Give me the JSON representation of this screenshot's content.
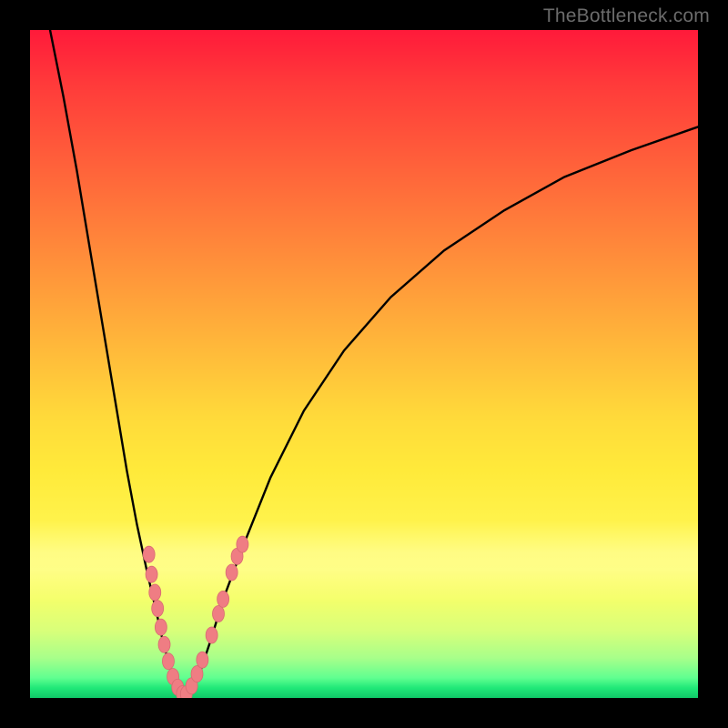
{
  "watermark": {
    "text": "TheBottleneck.com"
  },
  "colors": {
    "frame": "#000000",
    "curve_stroke": "#000000",
    "marker_fill": "#ef7d83",
    "marker_stroke": "#d86a72"
  },
  "chart_data": {
    "type": "line",
    "title": "",
    "xlabel": "",
    "ylabel": "",
    "xlim": [
      0,
      100
    ],
    "ylim": [
      0,
      100
    ],
    "series": [
      {
        "name": "left-branch",
        "x": [
          3,
          5,
          7,
          9,
          11,
          13,
          14.5,
          16,
          17.5,
          19,
          20,
          21,
          21.8,
          22.5,
          23
        ],
        "y": [
          100,
          90,
          79,
          67,
          55,
          43,
          34,
          26,
          19,
          12.5,
          8,
          4.5,
          2.2,
          0.8,
          0.2
        ]
      },
      {
        "name": "right-branch",
        "x": [
          23,
          24,
          25.5,
          27,
          29,
          32,
          36,
          41,
          47,
          54,
          62,
          71,
          80,
          90,
          100
        ],
        "y": [
          0.2,
          1.2,
          4,
          8.5,
          15,
          23,
          33,
          43,
          52,
          60,
          67,
          73,
          78,
          82,
          85.5
        ]
      }
    ],
    "markers": [
      {
        "x": 17.8,
        "y": 21.5
      },
      {
        "x": 18.2,
        "y": 18.5
      },
      {
        "x": 18.7,
        "y": 15.8
      },
      {
        "x": 19.1,
        "y": 13.4
      },
      {
        "x": 19.6,
        "y": 10.6
      },
      {
        "x": 20.1,
        "y": 8.0
      },
      {
        "x": 20.7,
        "y": 5.5
      },
      {
        "x": 21.4,
        "y": 3.2
      },
      {
        "x": 22.1,
        "y": 1.6
      },
      {
        "x": 22.8,
        "y": 0.6
      },
      {
        "x": 23.4,
        "y": 0.6
      },
      {
        "x": 24.2,
        "y": 1.8
      },
      {
        "x": 25.0,
        "y": 3.6
      },
      {
        "x": 25.8,
        "y": 5.7
      },
      {
        "x": 27.2,
        "y": 9.4
      },
      {
        "x": 28.2,
        "y": 12.6
      },
      {
        "x": 28.9,
        "y": 14.8
      },
      {
        "x": 30.2,
        "y": 18.8
      },
      {
        "x": 31.0,
        "y": 21.2
      },
      {
        "x": 31.8,
        "y": 23.0
      }
    ],
    "notes": "Bottleneck-style V curve. x≈23 is the minimum (0% bottleneck). y is percentage bottleneck. Background hue encodes severity: green near bottom (good), red near top (bad)."
  }
}
